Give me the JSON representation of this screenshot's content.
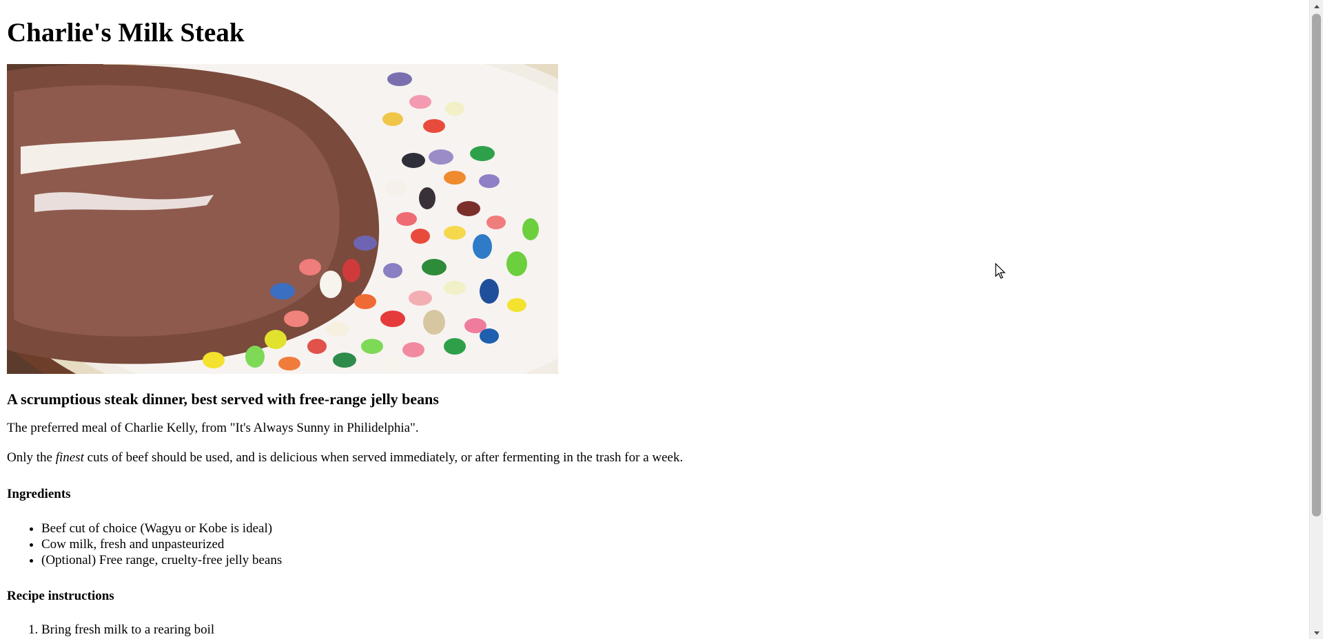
{
  "page": {
    "title": "Charlie's Milk Steak",
    "image_alt": "Steak in milk with jelly beans on a plate",
    "subtitle": "A scrumptious steak dinner, best served with free-range jelly beans",
    "intro": "The preferred meal of Charlie Kelly, from \"It's Always Sunny in Philidelphia\".",
    "desc_before": "Only the ",
    "desc_em": "finest",
    "desc_after": " cuts of beef should be used, and is delicious when served immediately, or after fermenting in the trash for a week.",
    "ingredients_heading": "Ingredients",
    "ingredients": [
      "Beef cut of choice (Wagyu or Kobe is ideal)",
      "Cow milk, fresh and unpasteurized",
      "(Optional) Free range, cruelty-free jelly beans"
    ],
    "instructions_heading": "Recipe instructions",
    "instructions": [
      "Bring fresh milk to a rearing boil"
    ]
  },
  "icons": {
    "scroll_up": "chevron-up-icon",
    "scroll_down": "chevron-down-icon",
    "cursor": "mouse-pointer-icon"
  },
  "colors": {
    "scrollbar_track": "#f0f0f0",
    "scrollbar_thumb": "#a8a8a8"
  }
}
